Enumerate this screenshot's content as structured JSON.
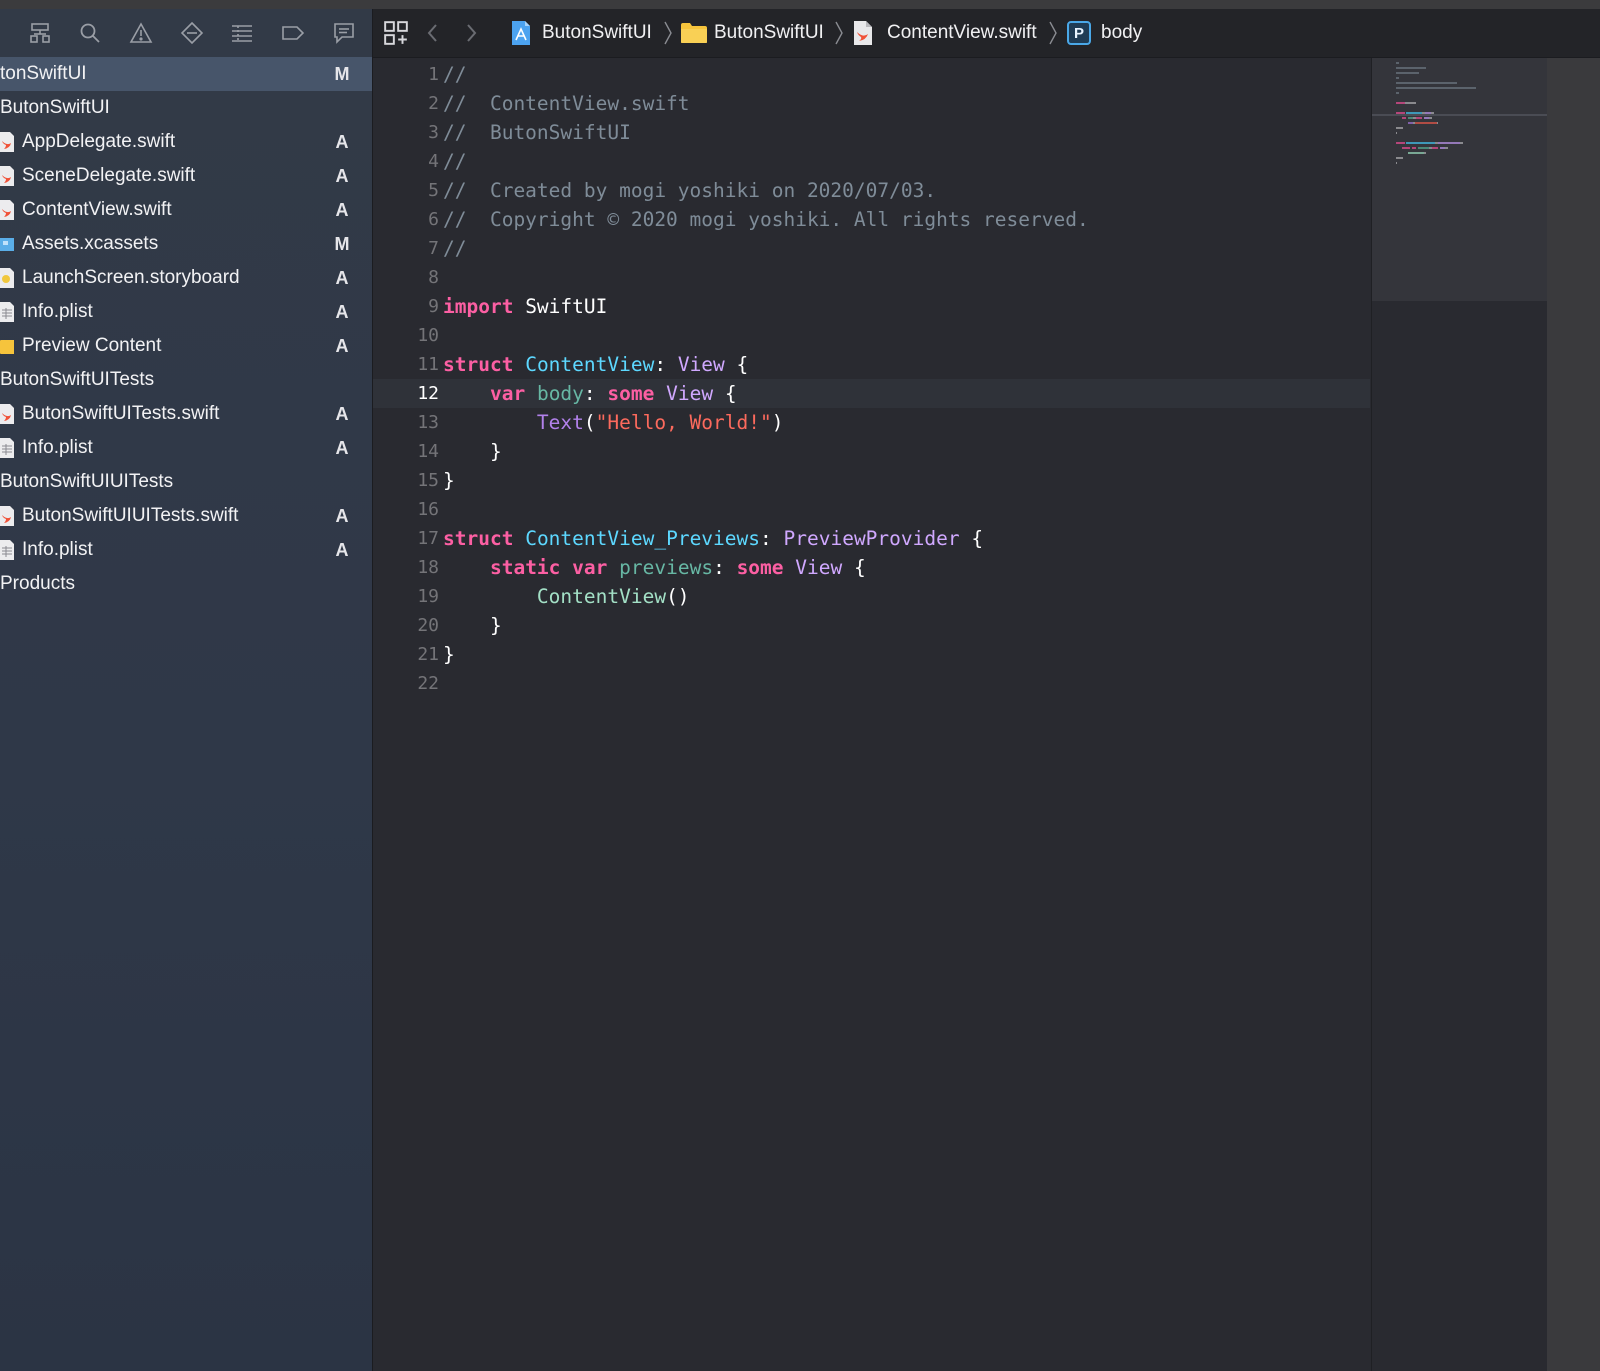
{
  "navigator": {
    "toolbar_icons": [
      "hierarchy-icon",
      "search-icon",
      "warning-icon",
      "breakpoint-icon",
      "list-icon",
      "tag-icon",
      "comment-icon"
    ],
    "items": [
      {
        "label": "tonSwiftUI",
        "status": "M",
        "icon": "none",
        "selected": true
      },
      {
        "label": "ButonSwiftUI",
        "status": "",
        "icon": "none"
      },
      {
        "label": "AppDelegate.swift",
        "status": "A",
        "icon": "swift-file-icon"
      },
      {
        "label": "SceneDelegate.swift",
        "status": "A",
        "icon": "swift-file-icon"
      },
      {
        "label": "ContentView.swift",
        "status": "A",
        "icon": "swift-file-icon"
      },
      {
        "label": "Assets.xcassets",
        "status": "M",
        "icon": "asset-catalog-icon"
      },
      {
        "label": "LaunchScreen.storyboard",
        "status": "A",
        "icon": "storyboard-icon"
      },
      {
        "label": "Info.plist",
        "status": "A",
        "icon": "plist-icon"
      },
      {
        "label": "Preview Content",
        "status": "A",
        "icon": "folder-icon"
      },
      {
        "label": "ButonSwiftUITests",
        "status": "",
        "icon": "none"
      },
      {
        "label": "ButonSwiftUITests.swift",
        "status": "A",
        "icon": "swift-file-icon"
      },
      {
        "label": "Info.plist",
        "status": "A",
        "icon": "plist-icon"
      },
      {
        "label": "ButonSwiftUIUITests",
        "status": "",
        "icon": "none"
      },
      {
        "label": "ButonSwiftUIUITests.swift",
        "status": "A",
        "icon": "swift-file-icon"
      },
      {
        "label": "Info.plist",
        "status": "A",
        "icon": "plist-icon"
      },
      {
        "label": "Products",
        "status": "",
        "icon": "none"
      }
    ]
  },
  "jumpbar": {
    "grid_icon": "related-items-icon",
    "back_icon": "chevron-left-icon",
    "forward_icon": "chevron-right-icon",
    "crumbs": [
      {
        "label": "ButonSwiftUI",
        "icon": "project-icon"
      },
      {
        "label": "ButonSwiftUI",
        "icon": "folder-icon"
      },
      {
        "label": "ContentView.swift",
        "icon": "swift-file-icon"
      },
      {
        "label": "body",
        "icon": "property-icon",
        "badge": "P"
      }
    ]
  },
  "editor": {
    "current_line": 12,
    "lines": [
      [
        [
          "comment",
          "//"
        ]
      ],
      [
        [
          "comment",
          "//  ContentView.swift"
        ]
      ],
      [
        [
          "comment",
          "//  ButonSwiftUI"
        ]
      ],
      [
        [
          "comment",
          "//"
        ]
      ],
      [
        [
          "comment",
          "//  Created by mogi yoshiki on 2020/07/03."
        ]
      ],
      [
        [
          "comment",
          "//  Copyright © 2020 mogi yoshiki. All rights reserved."
        ]
      ],
      [
        [
          "comment",
          "//"
        ]
      ],
      [],
      [
        [
          "kw",
          "import"
        ],
        [
          "plain",
          " SwiftUI"
        ]
      ],
      [],
      [
        [
          "kw",
          "struct"
        ],
        [
          "plain",
          " "
        ],
        [
          "type",
          "ContentView"
        ],
        [
          "plain",
          ": "
        ],
        [
          "cls",
          "View"
        ],
        [
          "plain",
          " {"
        ]
      ],
      [
        [
          "plain",
          "    "
        ],
        [
          "kw",
          "var"
        ],
        [
          "plain",
          " "
        ],
        [
          "var",
          "body"
        ],
        [
          "plain",
          ": "
        ],
        [
          "kw",
          "some"
        ],
        [
          "plain",
          " "
        ],
        [
          "cls",
          "View"
        ],
        [
          "plain",
          " {"
        ]
      ],
      [
        [
          "plain",
          "        "
        ],
        [
          "method",
          "Text"
        ],
        [
          "plain",
          "("
        ],
        [
          "str",
          "\"Hello, World!\""
        ],
        [
          "plain",
          ")"
        ]
      ],
      [
        [
          "plain",
          "    }"
        ]
      ],
      [
        [
          "plain",
          "}"
        ]
      ],
      [],
      [
        [
          "kw",
          "struct"
        ],
        [
          "plain",
          " "
        ],
        [
          "type",
          "ContentView_Previews"
        ],
        [
          "plain",
          ": "
        ],
        [
          "cls",
          "PreviewProvider"
        ],
        [
          "plain",
          " {"
        ]
      ],
      [
        [
          "plain",
          "    "
        ],
        [
          "kw",
          "static"
        ],
        [
          "plain",
          " "
        ],
        [
          "kw",
          "var"
        ],
        [
          "plain",
          " "
        ],
        [
          "var",
          "previews"
        ],
        [
          "plain",
          ": "
        ],
        [
          "kw",
          "some"
        ],
        [
          "plain",
          " "
        ],
        [
          "cls",
          "View"
        ],
        [
          "plain",
          " {"
        ]
      ],
      [
        [
          "plain",
          "        "
        ],
        [
          "ctor",
          "ContentView"
        ],
        [
          "plain",
          "()"
        ]
      ],
      [
        [
          "plain",
          "    }"
        ]
      ],
      [
        [
          "plain",
          "}"
        ]
      ],
      []
    ]
  },
  "colors": {
    "comment": "#7f8c98",
    "keyword": "#fc5fa3",
    "type_declaration": "#5dd8ff",
    "other_type": "#d0a8ff",
    "string": "#fc6a5d",
    "property": "#67b7a4",
    "editor_background": "#292a30",
    "selection": "#47556a"
  }
}
